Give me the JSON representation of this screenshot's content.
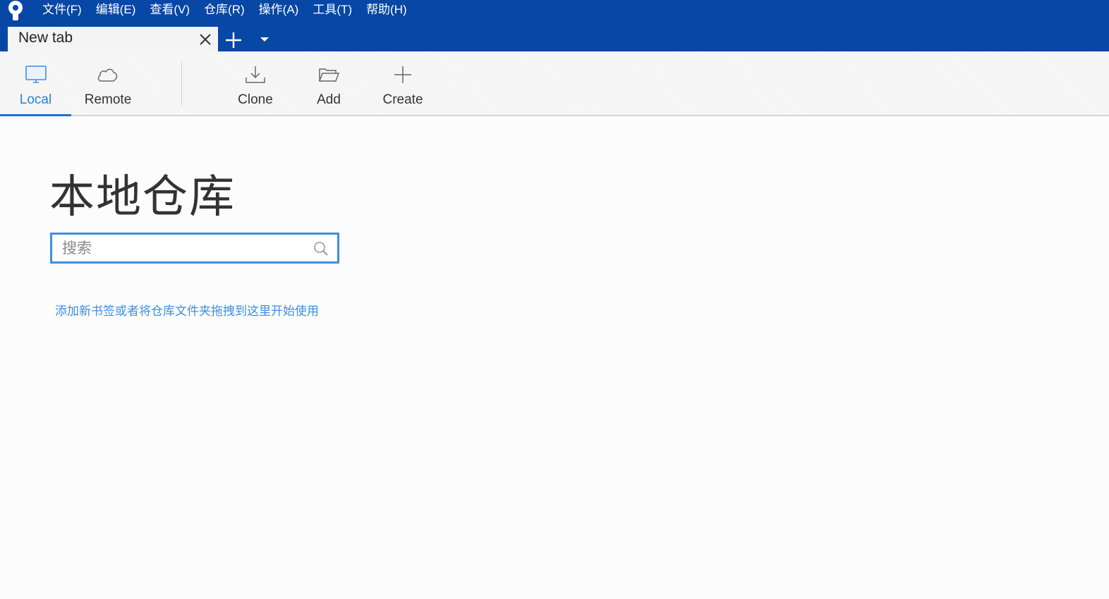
{
  "menu": {
    "items": [
      "文件(F)",
      "编辑(E)",
      "查看(V)",
      "仓库(R)",
      "操作(A)",
      "工具(T)",
      "帮助(H)"
    ]
  },
  "tabs": [
    {
      "label": "New tab",
      "active": true
    }
  ],
  "toolbar": {
    "local": "Local",
    "remote": "Remote",
    "clone": "Clone",
    "add": "Add",
    "create": "Create"
  },
  "main": {
    "title": "本地仓库",
    "search_placeholder": "搜索",
    "hint": "添加新书签或者将仓库文件夹拖拽到这里开始使用"
  },
  "colors": {
    "titlebar": "#0747a6",
    "accent": "#3d8fe0"
  }
}
